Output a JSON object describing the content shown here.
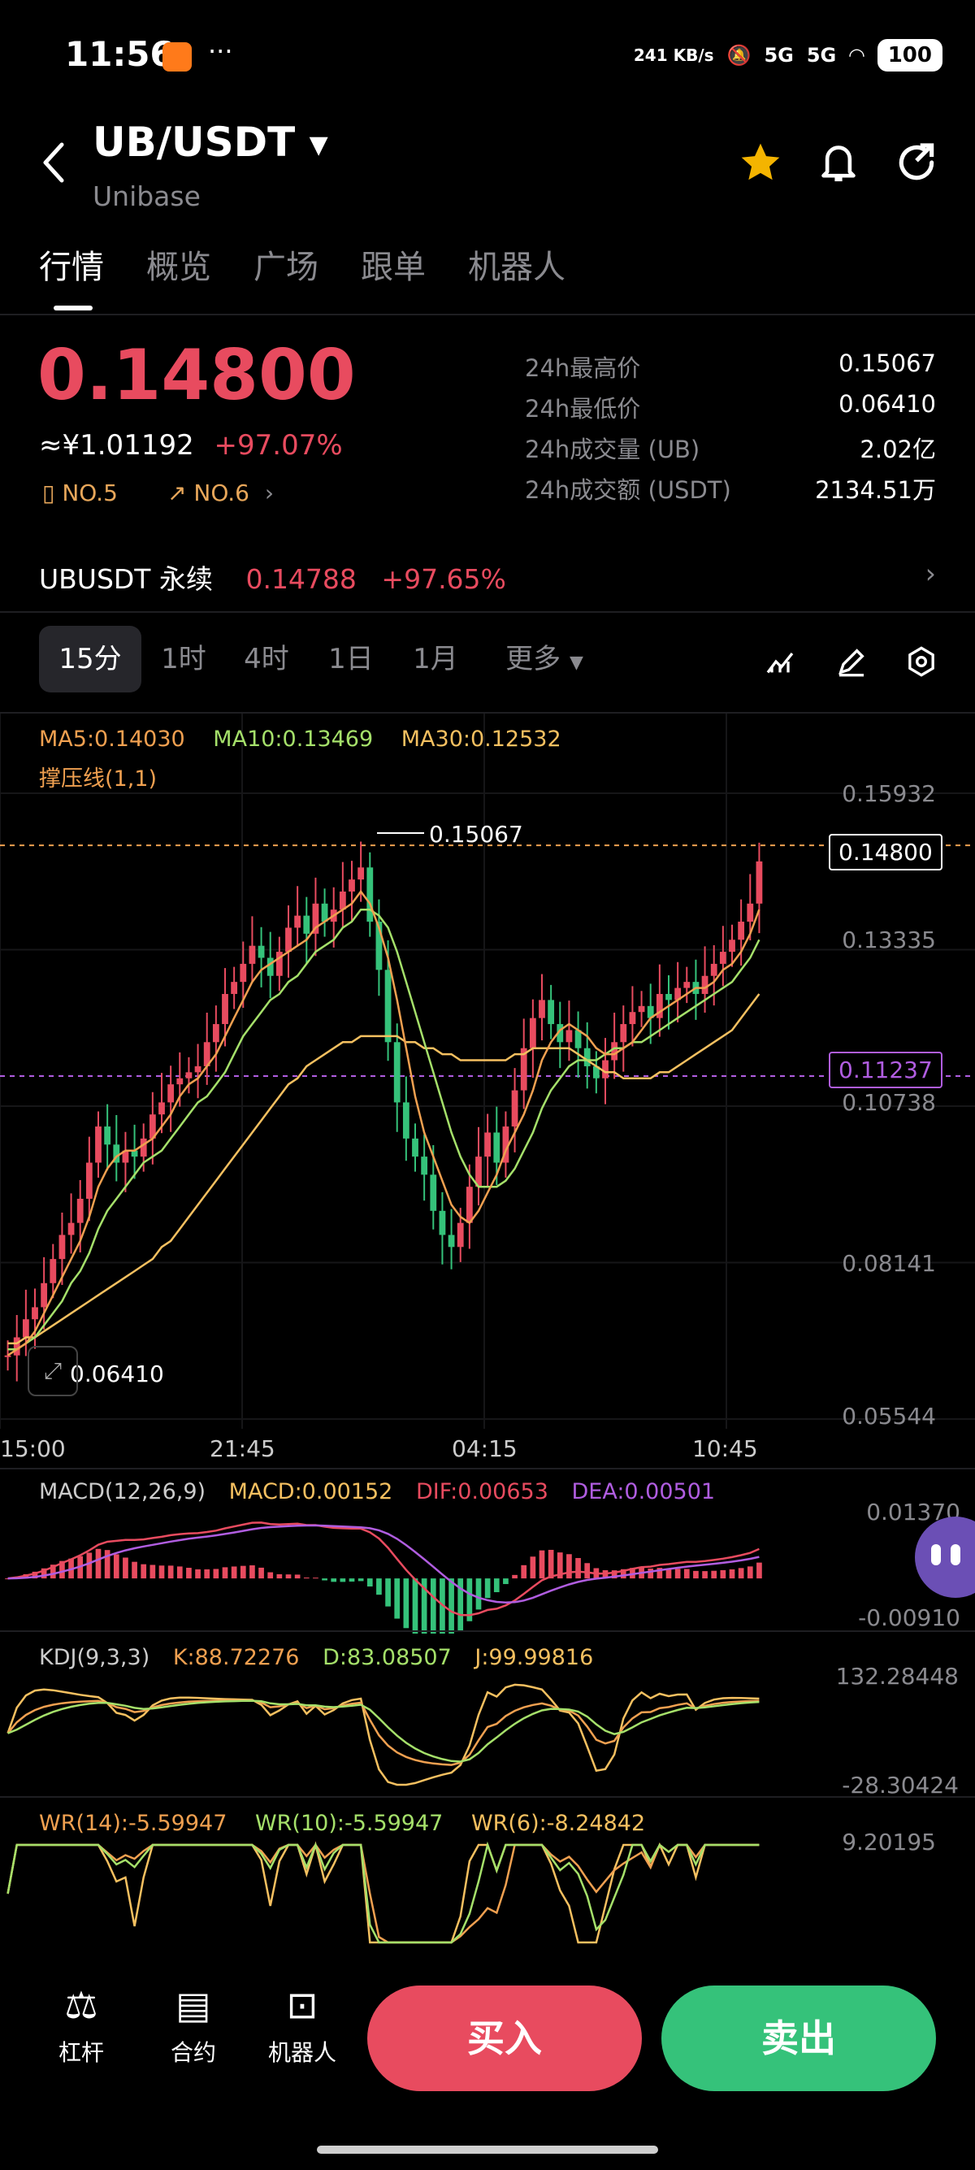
{
  "status_bar": {
    "time": "11:56",
    "dots": "···",
    "net_speed": "241 KB/s",
    "signal1": "5G",
    "signal2": "5G",
    "battery": "100"
  },
  "header": {
    "pair": "UB/USDT",
    "name": "Unibase",
    "icons": [
      "back-icon",
      "dropdown-icon",
      "star-icon",
      "bell-icon",
      "share-icon"
    ],
    "star_color": "#f4b400"
  },
  "tabs": [
    "行情",
    "概览",
    "广场",
    "跟单",
    "机器人"
  ],
  "price": {
    "last": "0.14800",
    "cny": "≈¥1.01192",
    "change": "+97.07%",
    "rank1": "NO.5",
    "rank2": "NO.6"
  },
  "stats": [
    {
      "label": "24h最高价",
      "value": "0.15067"
    },
    {
      "label": "24h最低价",
      "value": "0.06410"
    },
    {
      "label": "24h成交量 (UB)",
      "value": "2.02亿"
    },
    {
      "label": "24h成交额 (USDT)",
      "value": "2134.51万"
    }
  ],
  "perp": {
    "label": "UBUSDT 永续",
    "price": "0.14788",
    "change": "+97.65%"
  },
  "intervals": [
    "15分",
    "1时",
    "4时",
    "1日",
    "1月",
    "更多"
  ],
  "colors": {
    "up": "#e84b5f",
    "down": "#35c27a",
    "ma5": "#f0a050",
    "ma10": "#a5e06a",
    "ma30": "#f5c060",
    "accent_purple": "#b05de0"
  },
  "chart_data": [
    {
      "type": "candlestick",
      "legend": {
        "ma5": "MA5:0.14030",
        "ma10": "MA10:0.13469",
        "ma30": "MA30:0.12532",
        "sr": "撑压线(1,1)"
      },
      "y_ticks": [
        "0.15932",
        "0.13335",
        "0.10738",
        "0.08141",
        "0.05544"
      ],
      "x_ticks": [
        "15:00",
        "21:45",
        "04:15",
        "10:45"
      ],
      "ylim": [
        0.05544,
        0.15932
      ],
      "high_label": "0.15067",
      "low_label": "0.06410",
      "last_label": "0.14800",
      "support_label": "0.11237",
      "close": [
        0.066,
        0.069,
        0.072,
        0.074,
        0.078,
        0.082,
        0.086,
        0.088,
        0.092,
        0.098,
        0.104,
        0.101,
        0.098,
        0.1,
        0.099,
        0.102,
        0.106,
        0.108,
        0.111,
        0.112,
        0.113,
        0.114,
        0.118,
        0.121,
        0.126,
        0.128,
        0.131,
        0.134,
        0.132,
        0.129,
        0.133,
        0.137,
        0.139,
        0.136,
        0.141,
        0.138,
        0.14,
        0.143,
        0.145,
        0.147,
        0.138,
        0.13,
        0.118,
        0.108,
        0.102,
        0.099,
        0.096,
        0.09,
        0.086,
        0.084,
        0.088,
        0.094,
        0.099,
        0.103,
        0.098,
        0.104,
        0.11,
        0.117,
        0.122,
        0.125,
        0.121,
        0.118,
        0.12,
        0.117,
        0.114,
        0.112,
        0.115,
        0.118,
        0.121,
        0.123,
        0.124,
        0.122,
        0.126,
        0.125,
        0.127,
        0.128,
        0.126,
        0.129,
        0.131,
        0.133,
        0.135,
        0.138,
        0.141,
        0.148
      ],
      "ma5": [
        0.066,
        0.067,
        0.068,
        0.07,
        0.073,
        0.076,
        0.079,
        0.082,
        0.085,
        0.089,
        0.094,
        0.097,
        0.099,
        0.1,
        0.1,
        0.101,
        0.102,
        0.104,
        0.106,
        0.109,
        0.111,
        0.112,
        0.114,
        0.116,
        0.119,
        0.122,
        0.125,
        0.128,
        0.13,
        0.131,
        0.132,
        0.133,
        0.134,
        0.135,
        0.137,
        0.138,
        0.139,
        0.14,
        0.141,
        0.143,
        0.141,
        0.137,
        0.132,
        0.125,
        0.117,
        0.109,
        0.103,
        0.099,
        0.095,
        0.091,
        0.089,
        0.088,
        0.09,
        0.093,
        0.096,
        0.1,
        0.103,
        0.106,
        0.11,
        0.115,
        0.118,
        0.12,
        0.121,
        0.12,
        0.119,
        0.117,
        0.116,
        0.116,
        0.117,
        0.118,
        0.12,
        0.122,
        0.123,
        0.124,
        0.125,
        0.126,
        0.127,
        0.127,
        0.128,
        0.13,
        0.131,
        0.133,
        0.136,
        0.14
      ],
      "ma10": [
        0.067,
        0.067,
        0.068,
        0.069,
        0.071,
        0.073,
        0.075,
        0.078,
        0.08,
        0.083,
        0.087,
        0.09,
        0.092,
        0.094,
        0.096,
        0.098,
        0.099,
        0.1,
        0.102,
        0.104,
        0.106,
        0.108,
        0.109,
        0.111,
        0.113,
        0.116,
        0.119,
        0.121,
        0.123,
        0.125,
        0.126,
        0.128,
        0.129,
        0.131,
        0.133,
        0.134,
        0.135,
        0.137,
        0.138,
        0.14,
        0.14,
        0.139,
        0.137,
        0.133,
        0.128,
        0.123,
        0.118,
        0.113,
        0.108,
        0.103,
        0.099,
        0.096,
        0.094,
        0.094,
        0.094,
        0.095,
        0.097,
        0.1,
        0.103,
        0.107,
        0.11,
        0.112,
        0.114,
        0.115,
        0.115,
        0.115,
        0.116,
        0.117,
        0.117,
        0.118,
        0.118,
        0.119,
        0.12,
        0.121,
        0.122,
        0.123,
        0.124,
        0.125,
        0.126,
        0.127,
        0.128,
        0.13,
        0.132,
        0.135
      ],
      "ma30": [
        0.068,
        0.068,
        0.069,
        0.069,
        0.07,
        0.071,
        0.072,
        0.073,
        0.074,
        0.075,
        0.076,
        0.077,
        0.078,
        0.079,
        0.08,
        0.081,
        0.082,
        0.084,
        0.085,
        0.087,
        0.089,
        0.091,
        0.093,
        0.095,
        0.097,
        0.099,
        0.101,
        0.103,
        0.105,
        0.107,
        0.109,
        0.111,
        0.112,
        0.114,
        0.115,
        0.116,
        0.117,
        0.118,
        0.118,
        0.119,
        0.119,
        0.119,
        0.119,
        0.119,
        0.118,
        0.118,
        0.117,
        0.117,
        0.116,
        0.116,
        0.115,
        0.115,
        0.115,
        0.115,
        0.115,
        0.115,
        0.116,
        0.116,
        0.117,
        0.117,
        0.117,
        0.117,
        0.117,
        0.116,
        0.115,
        0.114,
        0.113,
        0.113,
        0.112,
        0.112,
        0.112,
        0.112,
        0.113,
        0.113,
        0.114,
        0.115,
        0.116,
        0.117,
        0.118,
        0.119,
        0.12,
        0.122,
        0.124,
        0.126
      ]
    },
    {
      "type": "macd",
      "legend": {
        "title": "MACD(12,26,9)",
        "macd": "MACD:0.00152",
        "dif": "DIF:0.00653",
        "dea": "DEA:0.00501"
      },
      "y_ticks": [
        "0.01370",
        "-0.00910"
      ],
      "ylim": [
        -0.0091,
        0.0137
      ]
    },
    {
      "type": "kdj",
      "legend": {
        "title": "KDJ(9,3,3)",
        "k": "K:88.72276",
        "d": "D:83.08507",
        "j": "J:99.99816"
      },
      "y_ticks": [
        "132.28448",
        "-28.30424"
      ],
      "ylim": [
        -28.30424,
        132.28448
      ]
    },
    {
      "type": "wr",
      "legend": {
        "wr14": "WR(14):-5.59947",
        "wr10": "WR(10):-5.59947",
        "wr6": "WR(6):-8.24842"
      },
      "y_ticks": [
        "9.20195"
      ]
    }
  ],
  "bottom_nav": [
    {
      "label": "杠杆",
      "icon": "leverage-icon"
    },
    {
      "label": "合约",
      "icon": "contract-icon"
    },
    {
      "label": "机器人",
      "icon": "robot-icon"
    }
  ],
  "actions": {
    "buy": "买入",
    "sell": "卖出"
  }
}
